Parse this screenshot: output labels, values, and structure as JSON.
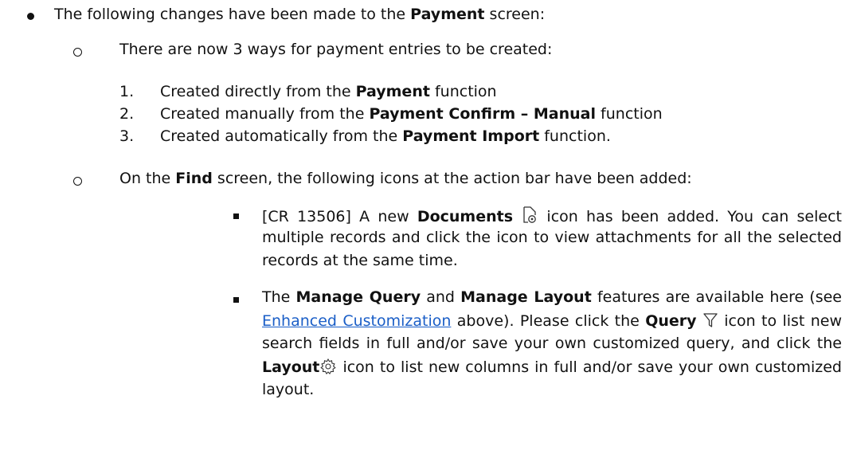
{
  "intro": {
    "pre": "The following changes have been made to the ",
    "bold": "Payment",
    "post": " screen:"
  },
  "ways": {
    "heading": "There are now 3 ways for payment entries to be created:",
    "items": [
      {
        "num": "1.",
        "pre": "Created directly from the ",
        "bold": "Payment",
        "post": " function"
      },
      {
        "num": "2.",
        "pre": "Created manually from the ",
        "bold": "Payment Confirm – Manual",
        "post": " function"
      },
      {
        "num": "3.",
        "pre": "Created automatically from the ",
        "bold": "Payment Import",
        "post": " function."
      }
    ]
  },
  "find": {
    "pre": "On the ",
    "bold": "Find",
    "post": " screen, the following icons at the action bar have been added:"
  },
  "documents_item": {
    "l1_pre": "[CR 13506] A new ",
    "l1_bold": "Documents",
    "l1_post": " icon has been added. You can select",
    "l2": "multiple records and click the icon to view attachments for all the selected",
    "l3": "records at the same time."
  },
  "manage_item": {
    "l1_a": "The ",
    "l1_b": "Manage Query",
    "l1_c": " and ",
    "l1_d": "Manage Layout",
    "l1_e": " features are available here (see",
    "l2_link": "Enhanced Customization",
    "l2_mid": " above). Please click the ",
    "l2_bold": "Query",
    "l2_post": " icon to list new",
    "l3": "search fields in full and/or save your own customized query, and click the",
    "l4_bold": "Layout",
    "l4_post": " icon to list new columns in full and/or save your own customized",
    "l5": "layout."
  },
  "icons": {
    "documents": "documents-icon",
    "query": "filter-icon",
    "layout": "gear-icon"
  }
}
